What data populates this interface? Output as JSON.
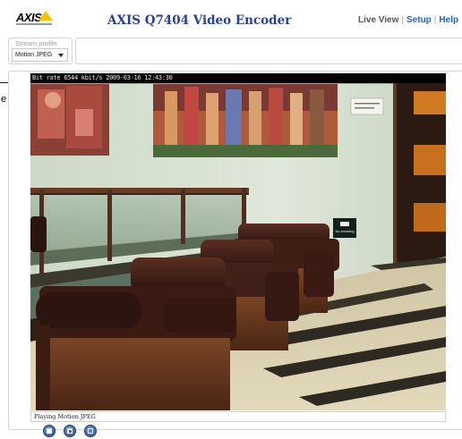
{
  "header": {
    "logo_text": "AXIS",
    "product_title": "AXIS Q7404 Video Encoder",
    "nav": {
      "live_view": "Live View",
      "separator": "|",
      "setup": "Setup",
      "help": "Help"
    }
  },
  "stream_profile": {
    "label": "Stream profile",
    "selected": "Motion JPEG"
  },
  "callout": {
    "text": "e"
  },
  "video": {
    "overlay_text": "Bit rate 6544 kbit/s 2009-03-16 12:43:30",
    "status_text": "Playing Motion JPEG",
    "signage_text": "No smoking"
  },
  "controls": {
    "buttons": [
      "stop-icon",
      "snapshot-icon",
      "view-full-screen-icon"
    ]
  },
  "colors": {
    "title_blue": "#27409a",
    "link_blue": "#2a62b8",
    "logo_yellow": "#f5c400",
    "control_blue": "#2a4f9c"
  }
}
